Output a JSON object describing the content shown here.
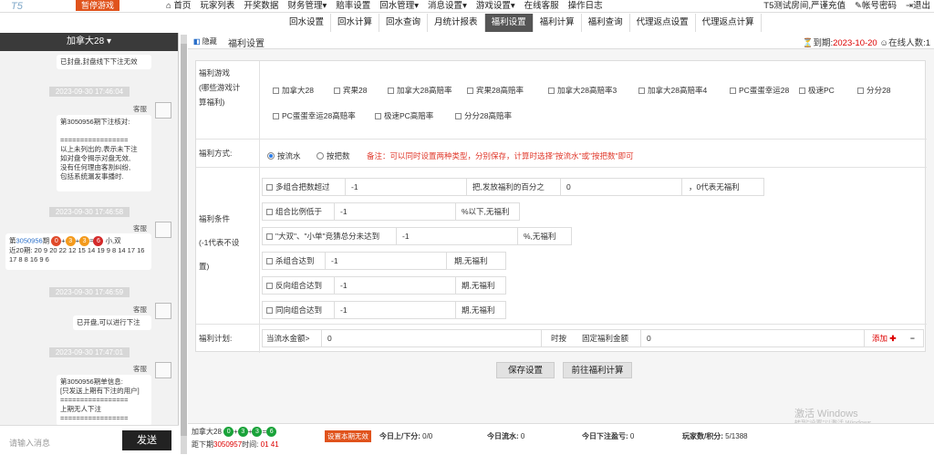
{
  "topbar": {
    "logo": "T5",
    "badge": "暂停游戏",
    "nav": [
      "首页",
      "玩家列表",
      "开奖数据",
      "财务管理",
      "赔率设置",
      "回水管理",
      "消息设置",
      "游戏设置",
      "在线客服",
      "操作日志"
    ],
    "right": [
      "T5测试房间,严谨充值",
      "帐号密码",
      "退出"
    ]
  },
  "subnav": {
    "tabs": [
      "回水设置",
      "回水计算",
      "回水查询",
      "月统计报表",
      "福利设置",
      "福利计算",
      "福利查询",
      "代理返点设置",
      "代理返点计算"
    ],
    "active": "福利设置"
  },
  "chat": {
    "title": "加拿大28",
    "messages": [
      {
        "text": "已封盘,封盘线下下注无效"
      },
      {
        "time": "2023-09-30 17:46:04",
        "sender": "客服",
        "text": "第3050956期下注核对:\n\n=================\n以上未列出的,表示未下注\n如对盘令揭示对盘无效,\n没有任何理由客割纠纷,\n包括系统漏发事播时."
      },
      {
        "time": "2023-09-30 17:46:58",
        "sender": "客服",
        "period": "3050956",
        "result": [
          "0",
          "3",
          "3",
          "6"
        ],
        "tail": "小,双",
        "history": "近20期: 20 9 20 22 12 15 14 19 9 8 14 17 16 17 8 8 16 9 6"
      },
      {
        "time": "2023-09-30 17:46:59",
        "sender": "客服",
        "text": "已开盘,可以进行下注"
      },
      {
        "time": "2023-09-30 17:47:01",
        "sender": "客服",
        "text": "第3050956期单信息:\n[只发送上期有下注的用户]\n=================\n上期无人下注\n================="
      }
    ],
    "input_placeholder": "请输入消息",
    "send_label": "发送"
  },
  "tabbar": {
    "hide": "隐藏",
    "tab": "福利设置",
    "expire_label": "到期:",
    "expire_date": "2023-10-20",
    "online": "在线人数:1"
  },
  "form": {
    "games_label": [
      "福利游戏",
      "(哪些游戏计",
      "算福利)"
    ],
    "games": [
      "加拿大28",
      "宾果28",
      "加拿大28高赔率",
      "宾果28高赔率",
      "加拿大28高赔率3",
      "加拿大28高赔率4",
      "PC蛋蛋幸运28",
      "极速PC",
      "分分28",
      "PC蛋蛋幸运28高赔率",
      "极速PC高赔率",
      "分分28高赔率"
    ],
    "mode_label": "福利方式:",
    "mode_options": [
      "按流水",
      "按把数"
    ],
    "mode_note": "备注：可以同时设置两种类型，分别保存，计算时选择\"按流水\"或\"按把数\"即可",
    "cond_label": [
      "福利条件",
      "(-1代表不设",
      "置)"
    ],
    "conditions": [
      {
        "label": "多组合把数超过",
        "value": "-1",
        "suffix": "把,发放福利的百分之",
        "value2": "0",
        "suffix2": "，0代表无福利"
      },
      {
        "label": "组合比例低于",
        "value": "-1",
        "suffix": "%以下,无福利"
      },
      {
        "label": "\"大双\"、\"小单\"竞猜总分未达到",
        "value": "-1",
        "suffix": "%,无福利"
      },
      {
        "label": "杀组合达到",
        "value": "-1",
        "suffix": "期,无福利"
      },
      {
        "label": "反向组合达到",
        "value": "-1",
        "suffix": "期,无福利"
      },
      {
        "label": "同向组合达到",
        "value": "-1",
        "suffix": "期,无福利"
      }
    ],
    "plan_label": "福利计划:",
    "plan": {
      "water_label": "当流水金额>",
      "water_value": "0",
      "when": "时按",
      "fixed_label": "固定福利金额",
      "fixed_value": "0",
      "add": "添加",
      "remove": "−"
    },
    "save": "保存设置",
    "goto": "前往福利计算"
  },
  "footer": {
    "game": "加拿大28",
    "balls": [
      "0",
      "3",
      "3",
      "6"
    ],
    "next_label": "距下期",
    "next_period": "3050957",
    "time_label": "时间:",
    "time_value": "01 41",
    "invalid_btn": "设置本期无效",
    "stats": [
      {
        "label": "今日上/下分:",
        "value": "0/0"
      },
      {
        "label": "今日流水:",
        "value": "0"
      },
      {
        "label": "今日下注盈亏:",
        "value": "0"
      },
      {
        "label": "玩家数/积分:",
        "value": "5/1388"
      }
    ]
  },
  "watermark": {
    "title": "激活 Windows",
    "sub": "转到\"设置\"以激活 Windows。"
  }
}
